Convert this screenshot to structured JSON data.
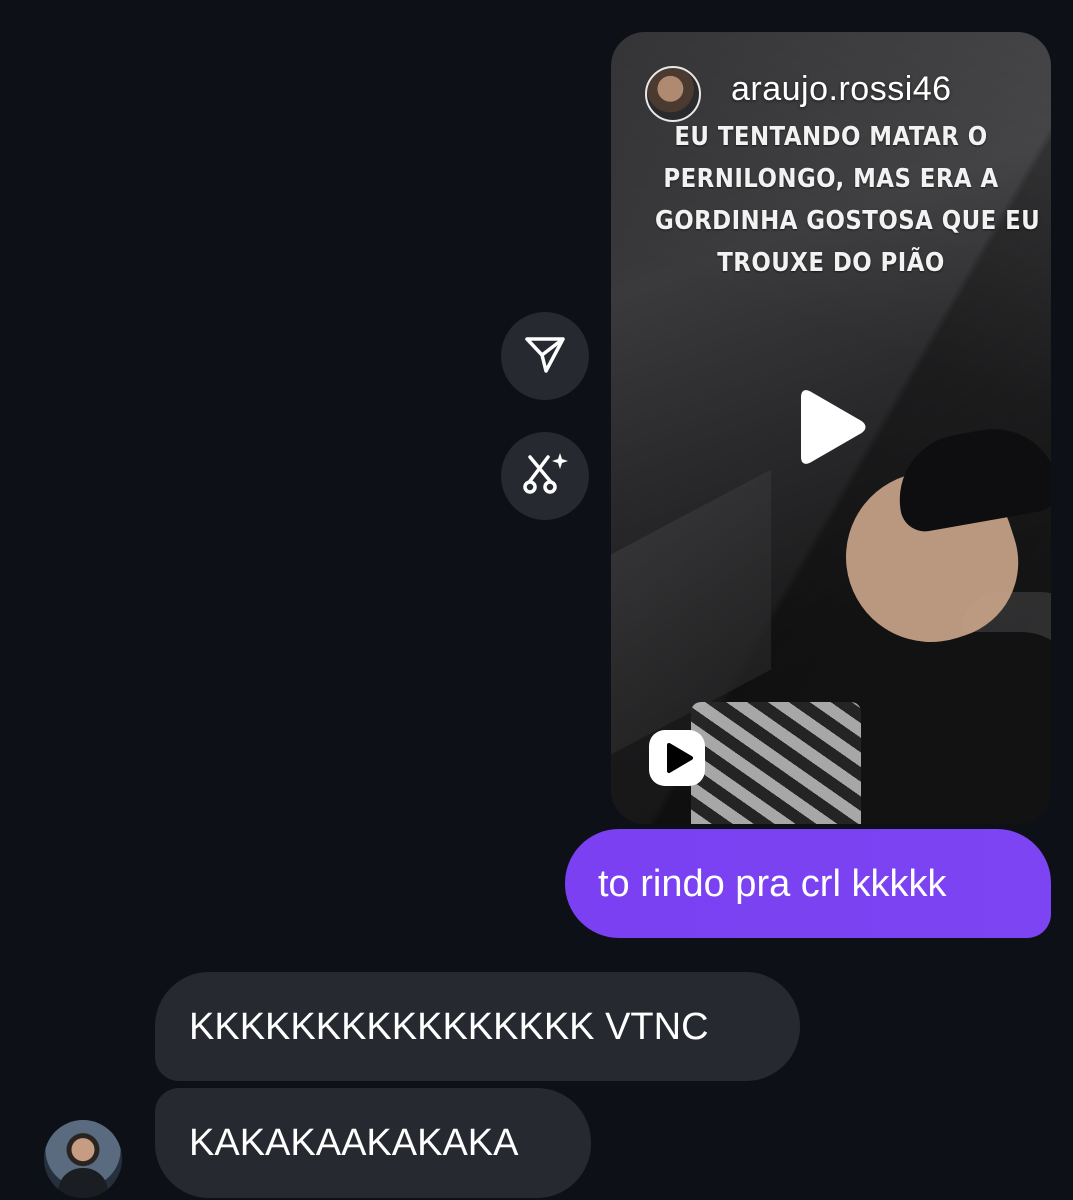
{
  "reel": {
    "username": "araujo.rossi46",
    "caption_lines": [
      "EU TENTANDO MATAR O",
      "PERNILONGO, MAS ERA A",
      "GORDINHA GOSTOSA QUE EU",
      "TROUXE DO PIÃO"
    ],
    "play_icon": "play-icon",
    "badge_icon": "reels-icon"
  },
  "actions": {
    "share_icon": "send-icon",
    "remix_icon": "remix-sparkle-icon"
  },
  "messages": {
    "sent": [
      {
        "text": "to rindo pra crl kkkkk"
      }
    ],
    "received": [
      {
        "text": "KKKKKKKKKKKKKKKK VTNC"
      },
      {
        "text": "KAKAKAAKAKAKA"
      }
    ]
  },
  "colors": {
    "background": "#0d1117",
    "sent_bubble": "#7a40f2",
    "received_bubble": "#26292f",
    "action_button": "#262a30"
  }
}
